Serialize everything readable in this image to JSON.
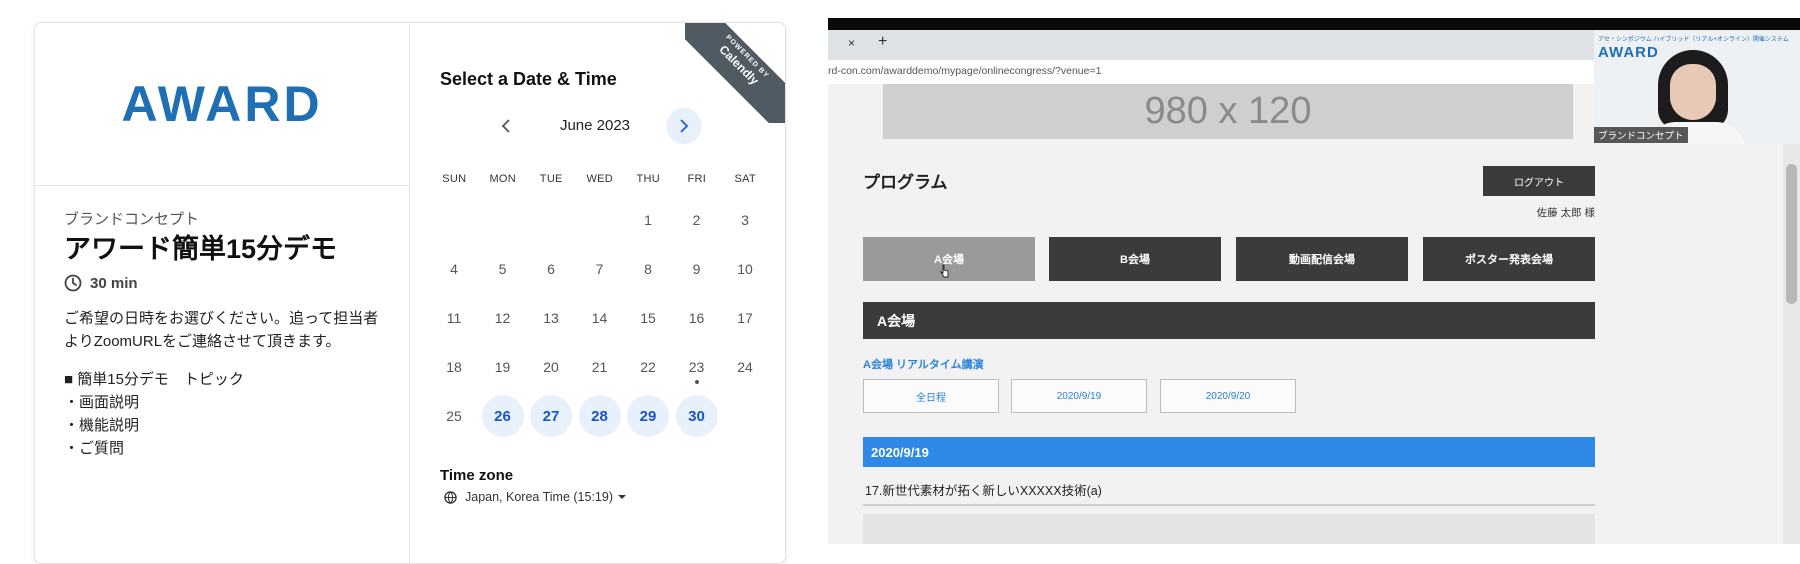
{
  "calendly": {
    "logo": "AWARD",
    "org_name": "ブランドコンセプト",
    "event_title": "アワード簡単15分デモ",
    "duration": "30 min",
    "description_lines": [
      "ご希望の日時をお選びください。追って担当者",
      "よりZoomURLをご連絡させて頂きます。"
    ],
    "topic_heading": "■ 簡単15分デモ　トピック",
    "topic_items": [
      "・画面説明",
      "・機能説明",
      "・ご質問"
    ],
    "select_title": "Select a Date & Time",
    "month": "June 2023",
    "weekdays": [
      "SUN",
      "MON",
      "TUE",
      "WED",
      "THU",
      "FRI",
      "SAT"
    ],
    "weeks": [
      [
        "",
        "",
        "",
        "",
        "1",
        "2",
        "3"
      ],
      [
        "4",
        "5",
        "6",
        "7",
        "8",
        "9",
        "10"
      ],
      [
        "11",
        "12",
        "13",
        "14",
        "15",
        "16",
        "17"
      ],
      [
        "18",
        "19",
        "20",
        "21",
        "22",
        "23",
        "24"
      ],
      [
        "25",
        "26",
        "27",
        "28",
        "29",
        "30",
        ""
      ]
    ],
    "available_days": [
      "26",
      "27",
      "28",
      "29",
      "30"
    ],
    "today": "23",
    "timezone_title": "Time zone",
    "timezone_value": "Japan, Korea Time (15:19)",
    "ribbon_small": "POWERED BY",
    "ribbon_big": "Calendly",
    "accent_color": "#1457c8"
  },
  "browser": {
    "tab_close": "×",
    "tab_new": "+",
    "url": "rd-con.com/awarddemo/mypage/onlinecongress/?venue=1"
  },
  "page": {
    "banner": "980 x 120",
    "program_title": "プログラム",
    "logout": "ログアウト",
    "user_name": "佐藤 太郎 様",
    "venues": [
      "A会場",
      "B会場",
      "動画配信会場",
      "ポスター発表会場"
    ],
    "active_venue": "A会場",
    "section_title": "A会場",
    "realtime_label": "A会場 リアルタイム講演",
    "dates": [
      "全日程",
      "2020/9/19",
      "2020/9/20"
    ],
    "day_header": "2020/9/19",
    "session_title": "17.新世代素材が拓く新しいXXXXX技術(a)"
  },
  "camera": {
    "logo_small": "アセ・シンポジウム ハイブリッド（リアル+オンライン）開催システム",
    "logo": "AWARD",
    "label": "ブランドコンセプト"
  }
}
